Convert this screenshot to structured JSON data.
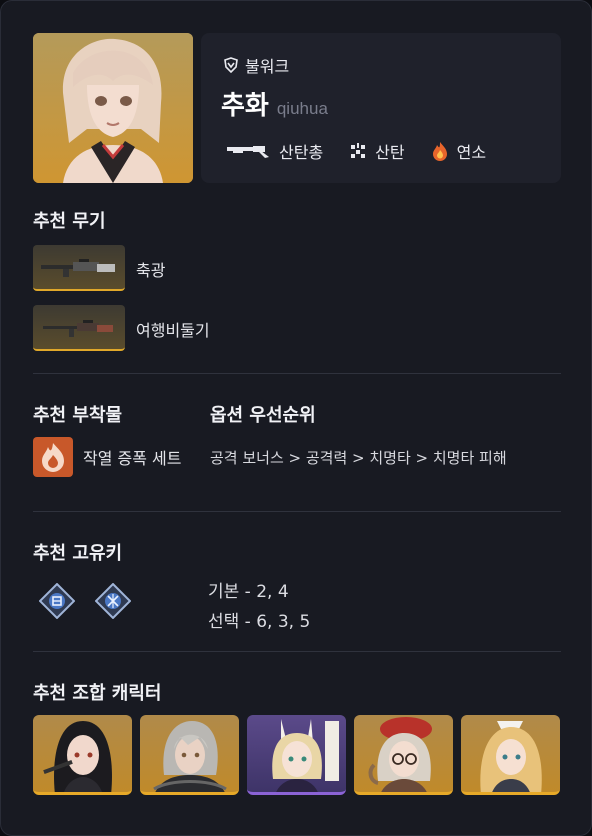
{
  "character": {
    "faction": "불워크",
    "name": "추화",
    "name_roman": "qiuhua",
    "weapon_type": "산탄총",
    "class": "산탄",
    "element": "연소",
    "icons": {
      "faction": "shield-icon",
      "weapon_type": "shotgun-icon",
      "class": "scatter-icon",
      "element": "fire-icon"
    }
  },
  "weapons": {
    "title": "추천 무기",
    "items": [
      {
        "name": "축광",
        "icon": "rifle-icon"
      },
      {
        "name": "여행비둘기",
        "icon": "rifle-icon"
      }
    ]
  },
  "attachments": {
    "title": "추천 부착물",
    "set_name": "작열 증폭 세트",
    "set_icon": "flame-icon",
    "priority_title": "옵션 우선순위",
    "priority": "공격 보너스 > 공격력 > 치명타 > 치명타 피해"
  },
  "keys": {
    "title": "추천 고유키",
    "icons": [
      "key-icon-a",
      "key-icon-b"
    ],
    "basic": "기본 - 2, 4",
    "optional": "선택 - 6, 3, 5"
  },
  "team": {
    "title": "추천 조합 캐릭터",
    "members": [
      "black-hair-character",
      "silver-hair-character",
      "bunny-ear-character",
      "red-hat-character",
      "blonde-character"
    ]
  },
  "colors": {
    "background": "#181a22",
    "panel": "#1f212b",
    "accent_gold": "#e0a82a",
    "accent_purple": "#8b63d6",
    "fire": "#e8652b"
  }
}
